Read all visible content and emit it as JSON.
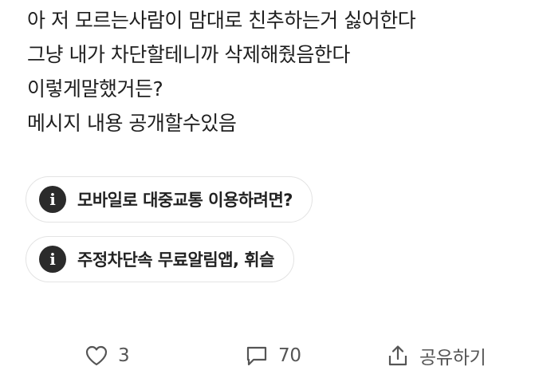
{
  "post": {
    "lines": [
      "아 저 모르는사람이 맘대로 친추하는거 싫어한다",
      "그냥 내가 차단할테니까 삭제해줬음한다",
      "이렇게말했거든?",
      "메시지 내용 공개할수있음"
    ]
  },
  "related_links": [
    {
      "label": "모바일로 대중교통 이용하려면?",
      "icon": "info-icon"
    },
    {
      "label": "주정차단속 무료알림앱, 휘슬",
      "icon": "info-icon"
    }
  ],
  "actions": {
    "like_count": "3",
    "comment_count": "70",
    "share_label": "공유하기"
  },
  "colors": {
    "icon_fill": "#2b2b2b",
    "chip_border": "#e3e3e3",
    "action_text": "#555555"
  }
}
